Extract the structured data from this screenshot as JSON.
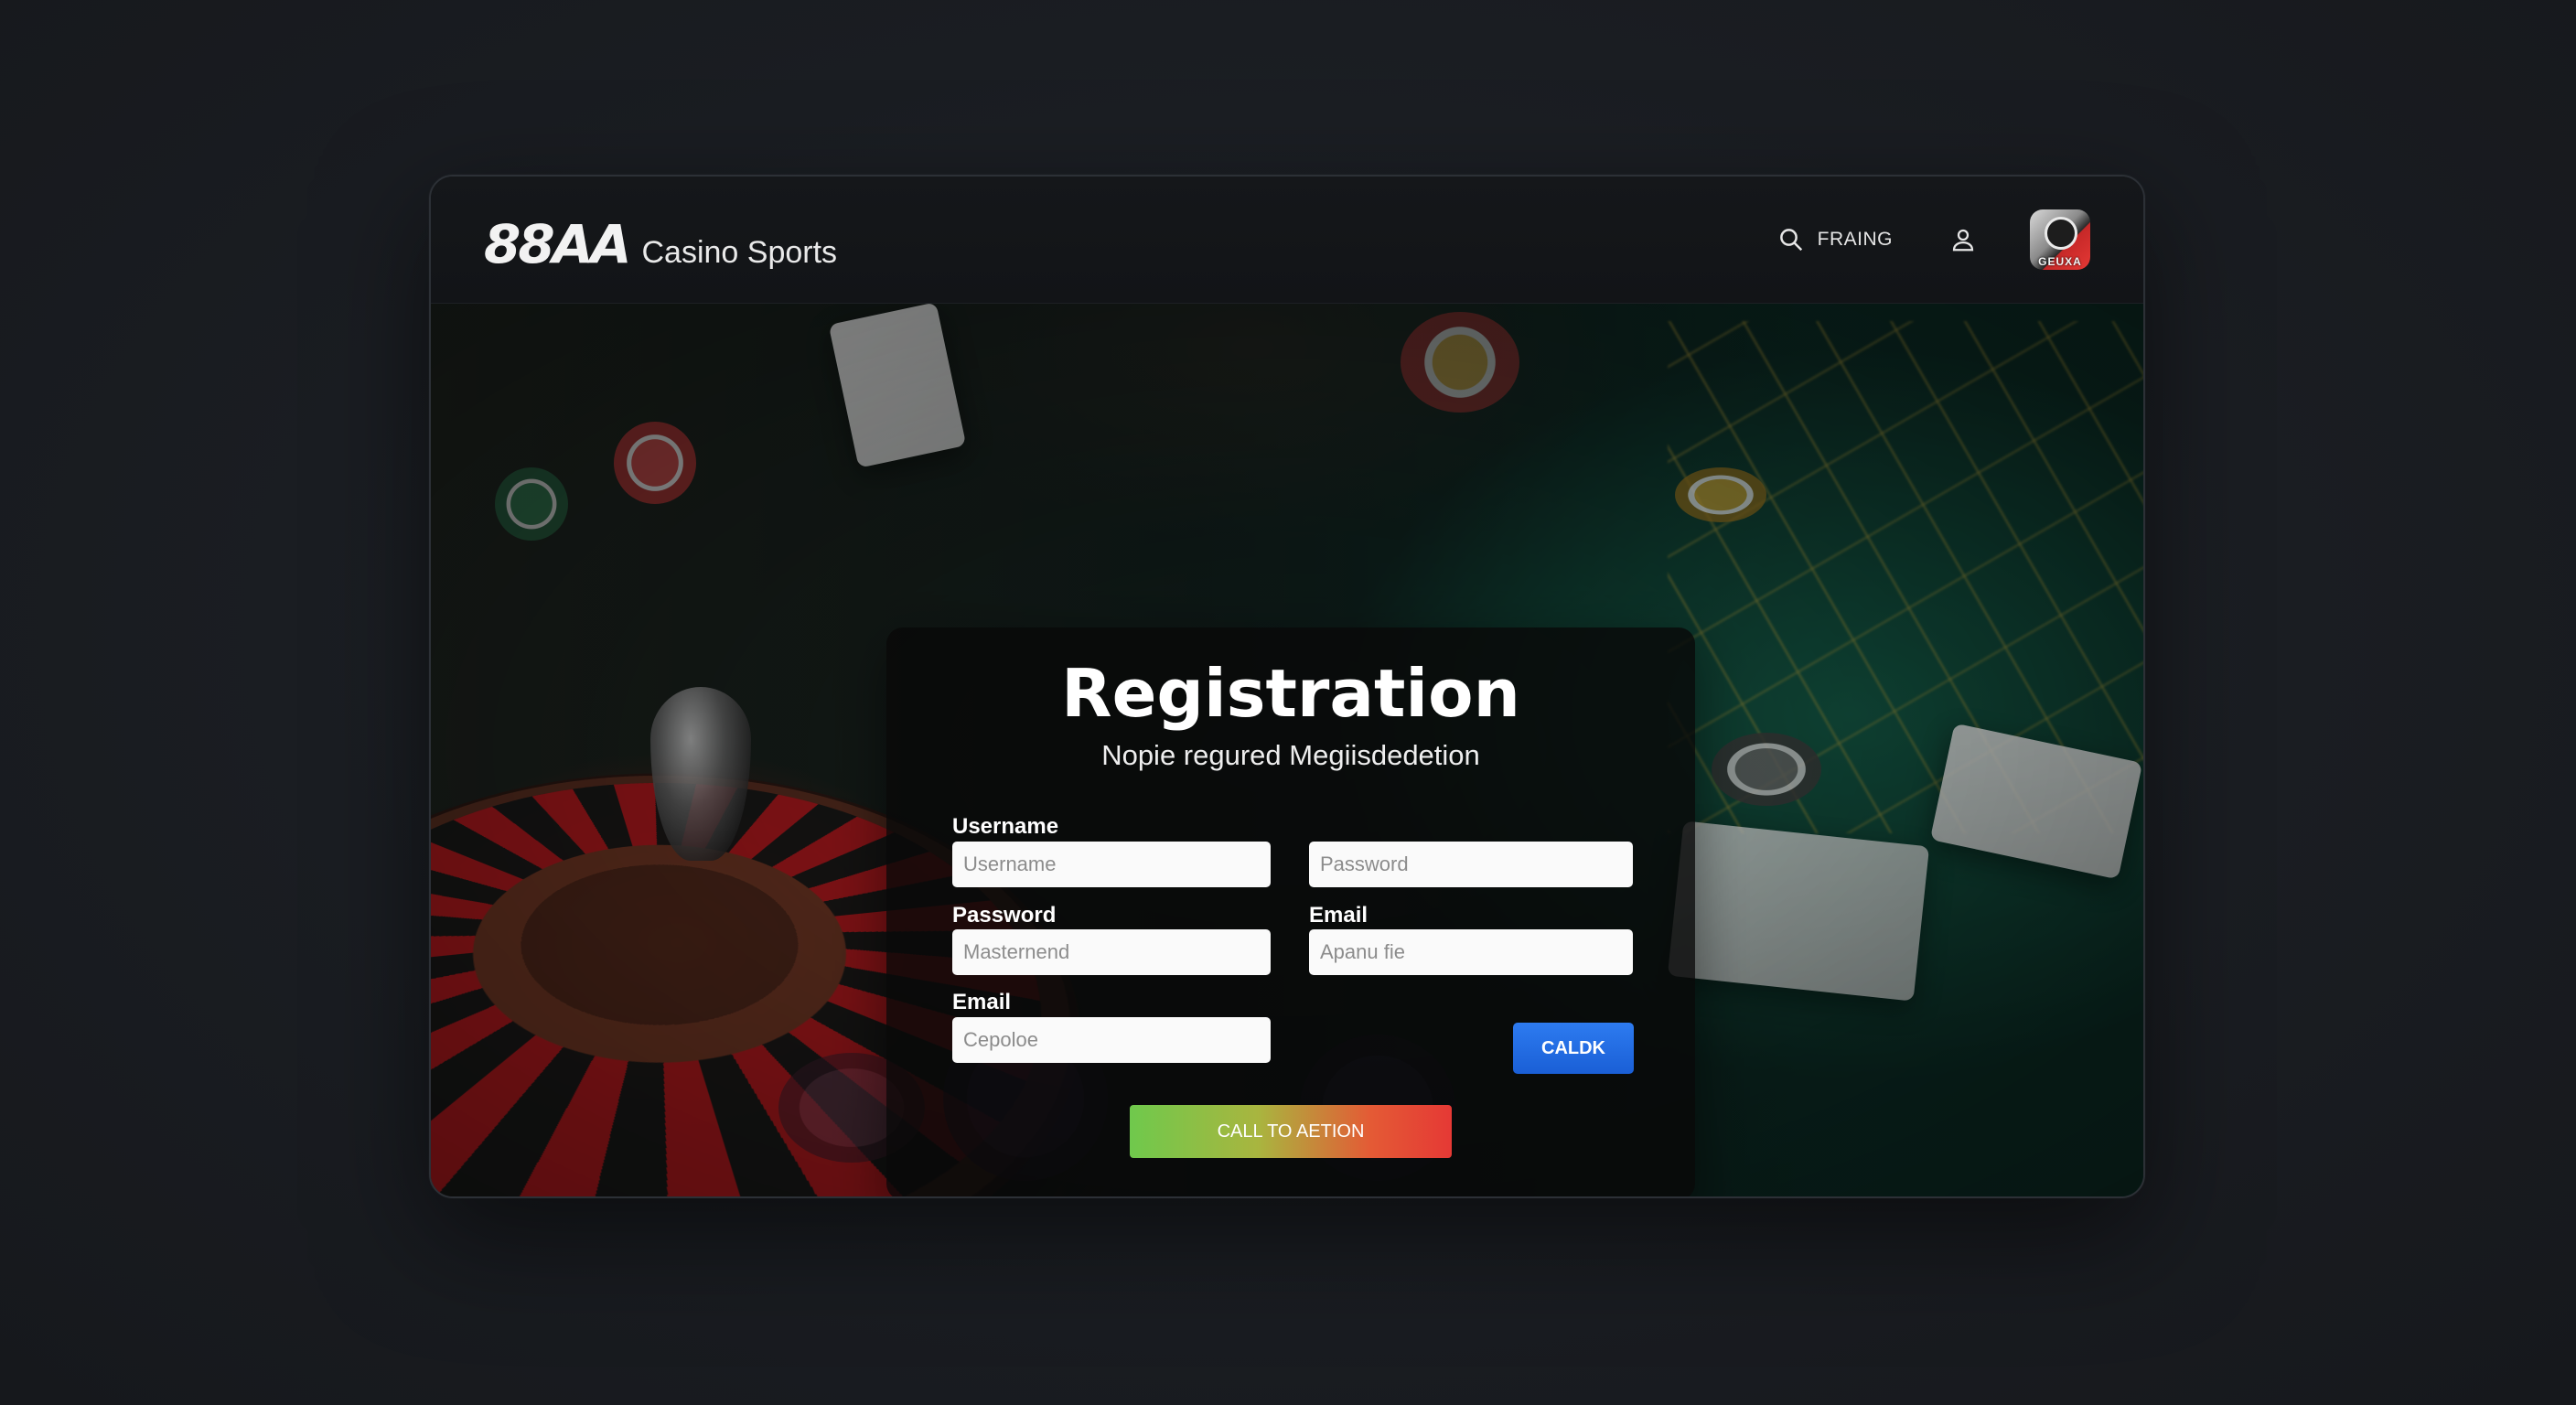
{
  "header": {
    "logo_mark": "88AA",
    "logo_text": "Casino Sports",
    "search_label": "FRAING",
    "avatar_label": "GEUXA"
  },
  "registration": {
    "title": "Registration",
    "subtitle": "Nopie regured Megiisdedetion",
    "fields": {
      "username_label": "Username",
      "username_placeholder": "Username",
      "password_label": "Password",
      "password_placeholder": "Masternend",
      "email_label": "Email",
      "email_placeholder": "Cepoloe",
      "right_top_placeholder": "Password",
      "right_email_label": "Email",
      "right_email_placeholder": "Apanu fie"
    },
    "buttons": {
      "small": "CALDK",
      "cta": "CALL TO AETION"
    }
  },
  "colors": {
    "cta_start": "#6fc94c",
    "cta_end": "#e53935",
    "button_blue": "#2d7bf0",
    "background": "#1a1d22"
  },
  "icons": [
    "search-icon",
    "user-icon",
    "avatar"
  ]
}
